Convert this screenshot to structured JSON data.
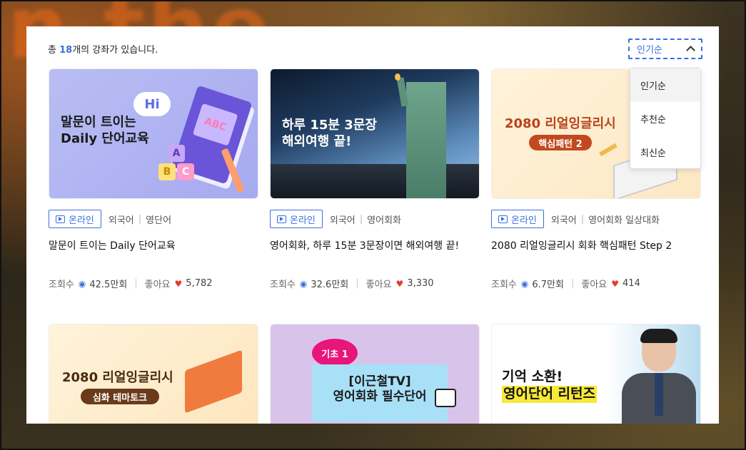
{
  "header": {
    "count_prefix": "총 ",
    "count_number": "18",
    "count_suffix": "개의 강좌가 있습니다."
  },
  "sort": {
    "selected": "인기순",
    "options": [
      "인기순",
      "추천순",
      "최신순"
    ]
  },
  "colors": {
    "accent": "#3b6fe0",
    "heart": "#e53b2f"
  },
  "cards": [
    {
      "thumb_line1": "말문이 트이는",
      "thumb_line2": "Daily 단어교육",
      "thumb_bubble": "Hi",
      "thumb_book": "ABC",
      "block_a": "A",
      "block_b": "B",
      "block_c": "C",
      "badge": "온라인",
      "category": "외국어",
      "subcategory": "영단어",
      "title": "말문이 트이는 Daily 단어교육",
      "views_label": "조회수",
      "views": "42.5만회",
      "likes_label": "좋아요",
      "likes": "5,782"
    },
    {
      "thumb_line1": "하루 15분 3문장",
      "thumb_line2": "해외여행 끝!",
      "badge": "온라인",
      "category": "외국어",
      "subcategory": "영어회화",
      "title": "영어회화, 하루 15분 3문장이면 해외여행 끝!",
      "views_label": "조회수",
      "views": "32.6만회",
      "likes_label": "좋아요",
      "likes": "3,330"
    },
    {
      "thumb_line1": "2080 리얼잉글리시",
      "thumb_line2": "핵심패턴 2",
      "badge": "온라인",
      "category": "외국어",
      "subcategory": "영어회화 일상대화",
      "title": "2080 리얼잉글리시 회화 핵심패턴 Step 2",
      "views_label": "조회수",
      "views": "6.7만회",
      "likes_label": "좋아요",
      "likes": "414"
    },
    {
      "thumb_line1": "2080 리얼잉글리시",
      "thumb_line2": "심화 테마토크"
    },
    {
      "thumb_tag": "기초 1",
      "thumb_line1": "[이근철TV]",
      "thumb_line2": "영어회화 필수단어"
    },
    {
      "thumb_line1": "기억 소환!",
      "thumb_line2": "영어단어 리턴즈"
    }
  ]
}
